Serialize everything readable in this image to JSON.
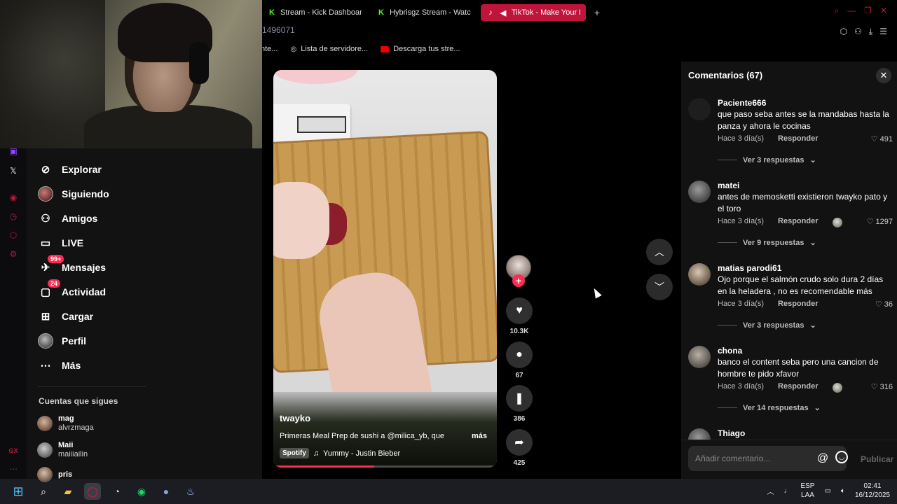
{
  "browser": {
    "tabs": [
      {
        "label": "Stream - Kick Dashboard",
        "icon": "kick-logo-icon",
        "active": false
      },
      {
        "label": "Hybrisgz Stream - Watch",
        "icon": "kick-logo-icon",
        "active": false
      },
      {
        "label": "TikTok - Make Your Da",
        "icon": "tiktok-logo-icon",
        "active": true,
        "audio": true
      }
    ],
    "address_fragment": "1496071",
    "bookmarks": [
      {
        "label": "nte..."
      },
      {
        "label": "Lista de servidore..."
      },
      {
        "label": "Descarga tus stre..."
      }
    ],
    "accent_color": "#c0153a"
  },
  "tiktok_nav": {
    "items": [
      {
        "label": "Explorar",
        "icon": "compass-icon"
      },
      {
        "label": "Siguiendo",
        "icon": "avatar-icon"
      },
      {
        "label": "Amigos",
        "icon": "friends-icon"
      },
      {
        "label": "LIVE",
        "icon": "live-tv-icon"
      },
      {
        "label": "Mensajes",
        "icon": "message-icon",
        "badge": "99+"
      },
      {
        "label": "Actividad",
        "icon": "activity-icon",
        "badge": "24"
      },
      {
        "label": "Cargar",
        "icon": "upload-icon"
      },
      {
        "label": "Perfil",
        "icon": "profile-avatar-icon"
      },
      {
        "label": "Más",
        "icon": "more-icon"
      }
    ],
    "following_title": "Cuentas que sigues",
    "following": [
      {
        "name": "mag",
        "handle": "alvrzmaga"
      },
      {
        "name": "Maii",
        "handle": "maiiiailin"
      },
      {
        "name": "pris",
        "handle": ""
      }
    ]
  },
  "video": {
    "author": "twayko",
    "description": "Primeras Meal Prep de sushi a @milica_yb, que",
    "more_label": "más",
    "music_badge": "Spotify",
    "music_title": "Yummy - Justin Bieber",
    "progress": 0.45,
    "likes": "10.3K",
    "comments": "67",
    "saves": "386",
    "shares": "425"
  },
  "comments_panel": {
    "title": "Comentarios (67)",
    "input_placeholder": "Añadir comentario...",
    "post_label": "Publicar",
    "items": [
      {
        "user": "Paciente666",
        "text": "que paso seba antes se la mandabas hasta la panza y ahora le cocinas",
        "time": "Hace 3 día(s)",
        "reply": "Responder",
        "likes": "491",
        "creator_liked": false,
        "replies": "Ver 3 respuestas"
      },
      {
        "user": "matei",
        "text": "antes de memosketti existieron twayko pato y el toro",
        "time": "Hace 3 día(s)",
        "reply": "Responder",
        "likes": "1297",
        "creator_liked": true,
        "replies": "Ver 9 respuestas"
      },
      {
        "user": "matias parodi61",
        "text": "Ojo porque el salmón crudo solo dura 2 días en la heladera , no es recomendable más",
        "time": "Hace 3 día(s)",
        "reply": "Responder",
        "likes": "36",
        "creator_liked": false,
        "replies": "Ver 3 respuestas"
      },
      {
        "user": "chona",
        "text": "banco el content seba pero una cancion de hombre te pido xfavor",
        "time": "Hace 3 día(s)",
        "reply": "Responder",
        "likes": "316",
        "creator_liked": true,
        "replies": "Ver 14 respuestas"
      },
      {
        "user": "Thiago",
        "text": "",
        "time": "",
        "reply": "",
        "likes": "",
        "creator_liked": false,
        "replies": ""
      }
    ]
  },
  "taskbar": {
    "lang_top": "ESP",
    "lang_bottom": "LAA",
    "time": "02:41",
    "date": "16/12/2025"
  }
}
